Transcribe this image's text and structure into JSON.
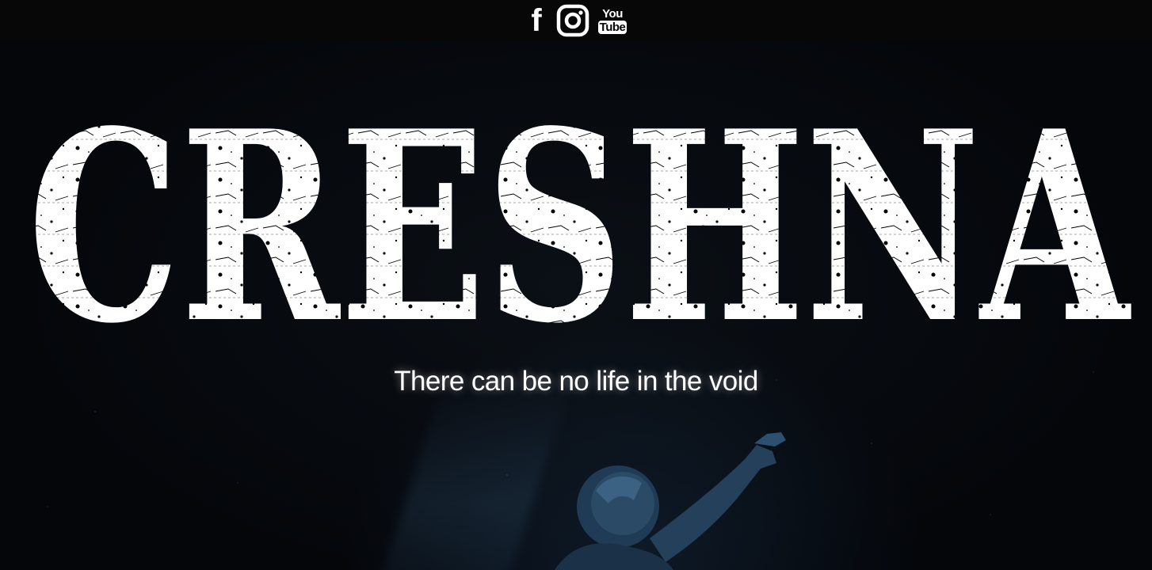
{
  "social": {
    "facebook": {
      "icon": "facebook-icon",
      "glyph": "f"
    },
    "instagram": {
      "icon": "instagram-icon"
    },
    "youtube": {
      "icon": "youtube-icon",
      "line1": "You",
      "line2": "Tube"
    }
  },
  "hero": {
    "brand": "CRESHNA",
    "tagline": "There can be no life in the void"
  },
  "colors": {
    "background": "#05070a",
    "topbar": "#070707",
    "text": "#ffffff",
    "astronaut": "#2b4a66"
  }
}
